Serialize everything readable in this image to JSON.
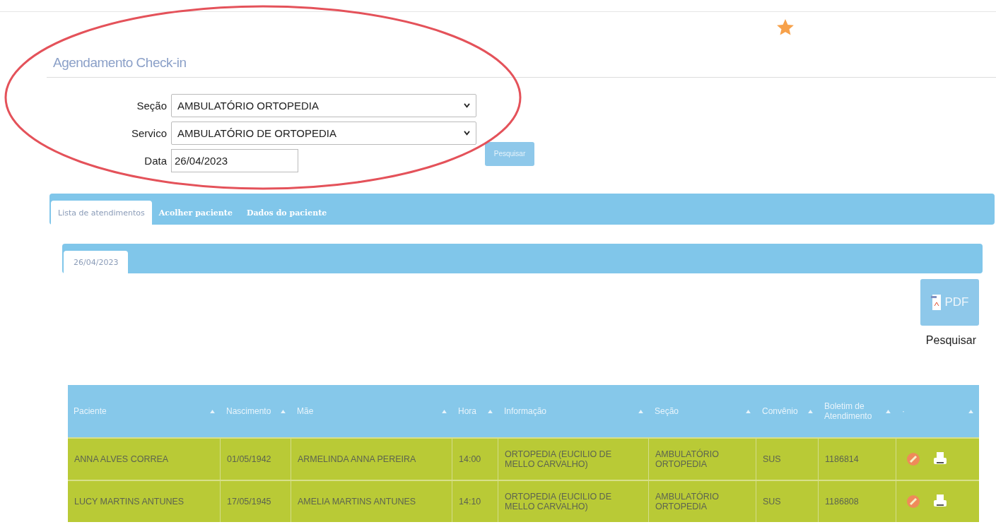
{
  "page_title": "Agendamento Check-in",
  "favorite": {
    "on": true
  },
  "form": {
    "fields": [
      {
        "label": "Seção",
        "kind": "select",
        "value": "AMBULATÓRIO ORTOPEDIA"
      },
      {
        "label": "Servico",
        "kind": "select",
        "value": "AMBULATÓRIO DE ORTOPEDIA"
      },
      {
        "label": "Data",
        "kind": "text",
        "value": "26/04/2023"
      }
    ],
    "search_button": "Pesquisar"
  },
  "annotation": {
    "kind": "ellipse"
  },
  "tabs": [
    {
      "label": "Lista de atendimentos",
      "selected": true
    },
    {
      "label": "Acolher paciente",
      "selected": false
    },
    {
      "label": "Dados do paciente",
      "selected": false
    }
  ],
  "date_tabs": [
    {
      "label": "26/04/2023",
      "selected": true
    }
  ],
  "pdf_button": {
    "label": "PDF"
  },
  "search_label": "Pesquisar",
  "table": {
    "columns": [
      {
        "label": "Paciente",
        "sortable": true
      },
      {
        "label": "Nascimento",
        "sortable": true
      },
      {
        "label": "Mãe",
        "sortable": true
      },
      {
        "label": "Hora",
        "sortable": true
      },
      {
        "label": "Informação",
        "sortable": true
      },
      {
        "label": "Seção",
        "sortable": true
      },
      {
        "label": "Convênio",
        "sortable": true
      },
      {
        "label": "Boletim de Atendimento",
        "sortable": true
      },
      {
        "label": "·",
        "sortable": true
      }
    ],
    "rows": [
      {
        "cells": [
          "ANNA ALVES CORREA",
          "01/05/1942",
          "ARMELINDA ANNA PEREIRA",
          "14:00",
          "ORTOPEDIA (EUCILIO DE MELLO CARVALHO)",
          "AMBULATÓRIO ORTOPEDIA",
          "SUS",
          "1186814"
        ]
      },
      {
        "cells": [
          "LUCY MARTINS ANTUNES",
          "17/05/1945",
          "AMELIA MARTINS ANTUNES",
          "14:10",
          "ORTOPEDIA (EUCILIO DE MELLO CARVALHO)",
          "AMBULATÓRIO ORTOPEDIA",
          "SUS",
          "1186808"
        ]
      }
    ]
  }
}
